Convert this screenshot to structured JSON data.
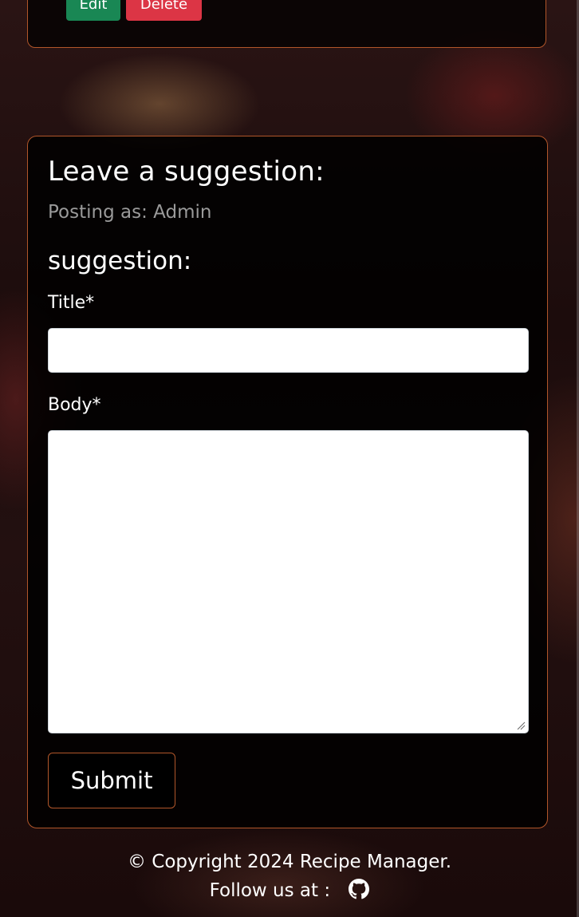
{
  "recipe_actions": {
    "edit_label": "Edit",
    "delete_label": "Delete"
  },
  "suggestion_form": {
    "heading": "Leave a suggestion:",
    "posting_as": "Posting as: Admin",
    "subheading": "suggestion:",
    "title_label": "Title*",
    "title_value": "",
    "body_label": "Body*",
    "body_value": "",
    "submit_label": "Submit"
  },
  "footer": {
    "copyright": "© Copyright 2024 Recipe Manager.",
    "follow_text": "Follow us at :",
    "social_icon": "github-icon"
  },
  "colors": {
    "card_border": "#b1562a",
    "edit_button": "#198754",
    "delete_button": "#dc3545",
    "muted_text": "#9a9a9a"
  }
}
